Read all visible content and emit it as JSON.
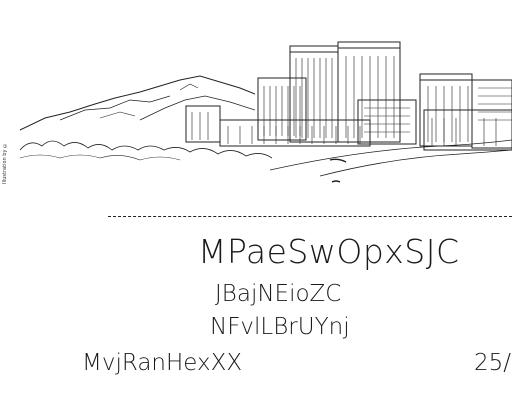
{
  "card": {
    "title": "MPaeSwOpxSJC",
    "line1": "JBajNEioZC",
    "line2": "NFvlLBrUYnj",
    "bottom_left": "MvjRanHexXX",
    "bottom_right": "25/",
    "illustration_credit": "Illustration by ©"
  }
}
